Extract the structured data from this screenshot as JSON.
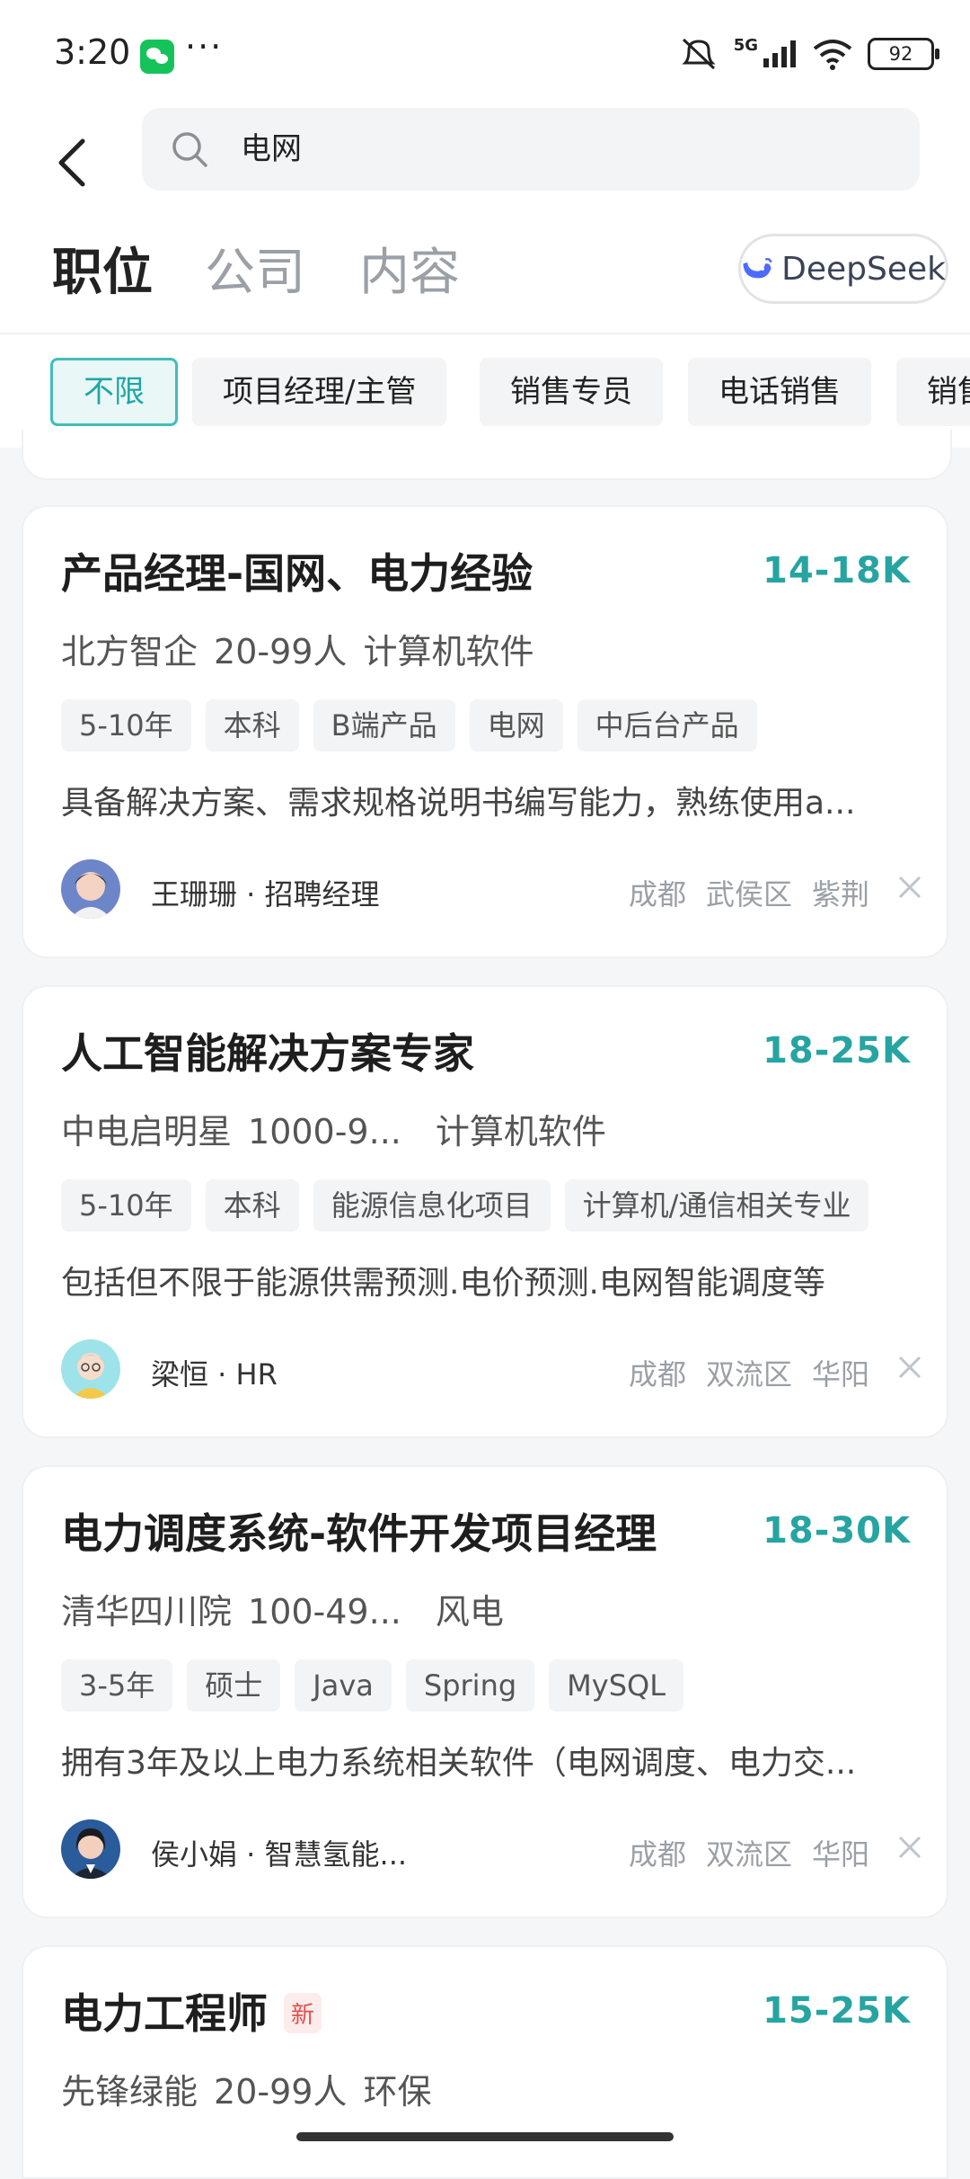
{
  "status_bar": {
    "time": "3:20",
    "dots": "···",
    "signal": "5G",
    "battery": "92"
  },
  "search": {
    "query": "电网"
  },
  "tabs": [
    {
      "label": "职位",
      "active": true
    },
    {
      "label": "公司",
      "active": false
    },
    {
      "label": "内容",
      "active": false
    }
  ],
  "deepseek": {
    "label": "DeepSeek"
  },
  "filters": [
    {
      "label": "不限",
      "active": true
    },
    {
      "label": "项目经理/主管",
      "active": false
    },
    {
      "label": "销售专员",
      "active": false
    },
    {
      "label": "电话销售",
      "active": false
    },
    {
      "label": "销售",
      "active": false
    }
  ],
  "jobs": [
    {
      "title": "产品经理-国网、电力经验",
      "salary": "14-18K",
      "company": "北方智企",
      "size": "20-99人",
      "industry": "计算机软件",
      "tags": [
        "5-10年",
        "本科",
        "B端产品",
        "电网",
        "中后台产品"
      ],
      "desc": "具备解决方案、需求规格说明书编写能力，熟练使用a...",
      "recruiter": "王珊珊 · 招聘经理",
      "city": "成都",
      "district": "武侯区",
      "area": "紫荆"
    },
    {
      "title": "人工智能解决方案专家",
      "salary": "18-25K",
      "company": "中电启明星",
      "size": "1000-9...",
      "industry": "计算机软件",
      "tags": [
        "5-10年",
        "本科",
        "能源信息化项目",
        "计算机/通信相关专业"
      ],
      "desc": "包括但不限于能源供需预测.电价预测.电网智能调度等",
      "recruiter": "梁恒 · HR",
      "city": "成都",
      "district": "双流区",
      "area": "华阳"
    },
    {
      "title": "电力调度系统-软件开发项目经理",
      "salary": "18-30K",
      "company": "清华四川院",
      "size": "100-49...",
      "industry": "风电",
      "tags": [
        "3-5年",
        "硕士",
        "Java",
        "Spring",
        "MySQL"
      ],
      "desc": "拥有3年及以上电力系统相关软件（电网调度、电力交...",
      "recruiter": "侯小娟 · 智慧氢能...",
      "city": "成都",
      "district": "双流区",
      "area": "华阳"
    },
    {
      "title": "电力工程师",
      "badge": "新",
      "salary": "15-25K",
      "company": "先锋绿能",
      "size": "20-99人",
      "industry": "环保"
    }
  ],
  "colors": {
    "accent": "#26a4a2",
    "badge": "#e0504a"
  }
}
